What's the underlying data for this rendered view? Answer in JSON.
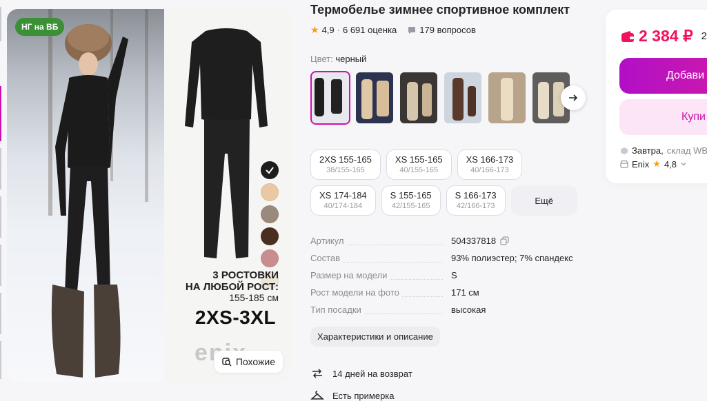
{
  "gallery": {
    "badge": "НГ на ВБ",
    "promo_line1": "3 РОСТОВКИ",
    "promo_line2": "НА ЛЮБОЙ РОСТ:",
    "promo_range": "155-185 см",
    "promo_sizes": "2XS-3XL",
    "brand_logo": "enix",
    "similar_label": "Похожие",
    "swatch_colors": [
      "#1c1c1c",
      "#e8c9a3",
      "#9a8a7c",
      "#4a2e20",
      "#c98d8f",
      "#ece6d8"
    ]
  },
  "product": {
    "title": "Термобелье зимнее спортивное комплект",
    "rating": "4,9",
    "reviews": "6 691 оценка",
    "questions": "179 вопросов",
    "color_label": "Цвет:",
    "color_value": "черный"
  },
  "thumbs": [
    {
      "bg": "#2a2a2a",
      "accent": "#f2f2f2"
    },
    {
      "bg": "#d9c2a0",
      "accent": "#2a2f45"
    },
    {
      "bg": "#3a3633",
      "accent": "#cbb79a"
    },
    {
      "bg": "#c2c7cf",
      "accent": "#5a3a2a"
    },
    {
      "bg": "#b7a48a",
      "accent": "#e8d8c0"
    },
    {
      "bg": "#6b6a68",
      "accent": "#e6dcc8"
    }
  ],
  "sizes": [
    {
      "main": "2XS 155-165",
      "sub": "38/155-165"
    },
    {
      "main": "XS 155-165",
      "sub": "40/155-165"
    },
    {
      "main": "XS 166-173",
      "sub": "40/166-173"
    },
    {
      "main": "XS 174-184",
      "sub": "40/174-184"
    },
    {
      "main": "S 155-165",
      "sub": "42/155-165"
    },
    {
      "main": "S 166-173",
      "sub": "42/166-173"
    }
  ],
  "sizes_more": "Ещё",
  "params": [
    {
      "name": "Артикул",
      "value": "504337818"
    },
    {
      "name": "Состав",
      "value": "93% полиэстер; 7% спандекс"
    },
    {
      "name": "Размер на модели",
      "value": "S"
    },
    {
      "name": "Рост модели на фото",
      "value": "171 см"
    },
    {
      "name": "Тип посадки",
      "value": "высокая"
    }
  ],
  "chars_button": "Характеристики и описание",
  "perks": {
    "return": "14 дней на возврат",
    "fitting": "Есть примерка"
  },
  "buy": {
    "price": "2 384 ₽",
    "price_old": "2",
    "add_label": "Добави",
    "buy_label": "Купи",
    "delivery_day": "Завтра,",
    "delivery_place": "склад WB",
    "seller_name": "Enix",
    "seller_rating": "4,8",
    "accent_color": "#cb11ab",
    "price_color": "#f0125a"
  }
}
